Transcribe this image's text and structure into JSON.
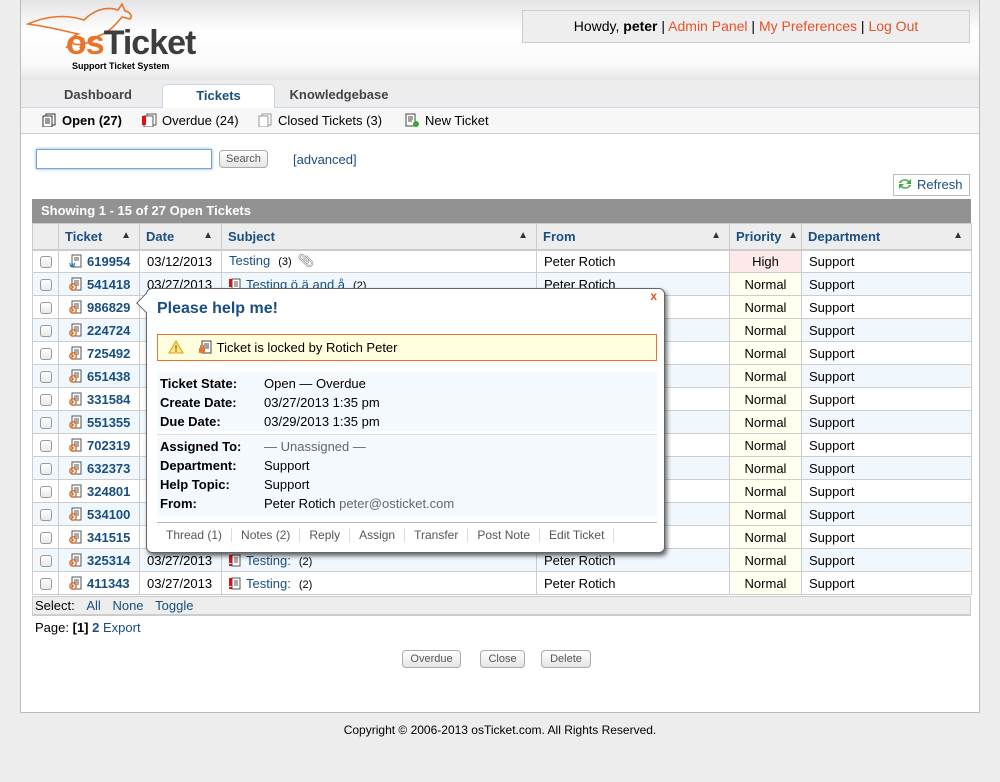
{
  "header": {
    "logo_os": "os",
    "logo_ticket": "Ticket",
    "tagline": "Support Ticket System",
    "greeting": "Howdy,",
    "username": "peter",
    "links": [
      "Admin Panel",
      "My Preferences",
      "Log Out"
    ],
    "link_color": "#e8502b"
  },
  "nav": {
    "tabs": [
      {
        "label": "Dashboard",
        "active": false
      },
      {
        "label": "Tickets",
        "active": true
      },
      {
        "label": "Knowledgebase",
        "active": false
      }
    ]
  },
  "subnav": {
    "items": [
      {
        "label": "Open (27)",
        "icon": "open-tickets-icon",
        "active": true
      },
      {
        "label": "Overdue (24)",
        "icon": "overdue-tickets-icon",
        "active": false
      },
      {
        "label": "Closed Tickets (3)",
        "icon": "closed-tickets-icon",
        "active": false
      },
      {
        "label": "New Ticket",
        "icon": "new-ticket-icon",
        "active": false
      }
    ]
  },
  "search": {
    "value": "",
    "placeholder": "",
    "button": "Search",
    "advanced": "[advanced]"
  },
  "refresh_label": "Refresh",
  "list": {
    "caption": "Showing  1 - 15 of 27   Open Tickets",
    "columns": [
      "Ticket",
      "Date",
      "Subject",
      "From",
      "Priority",
      "Department"
    ],
    "rows": [
      {
        "ticket": "619954",
        "source": "web",
        "date": "03/12/2013",
        "subject": "Testing",
        "overdue": false,
        "count": "(3)",
        "attachment": true,
        "from": "Peter Rotich",
        "priority": "High",
        "dept": "Support"
      },
      {
        "ticket": "541418",
        "source": "email",
        "date": "03/27/2013",
        "subject": "Testing ö.ä and å",
        "overdue": true,
        "count": "(2)",
        "attachment": false,
        "from": "Peter Rotich",
        "priority": "Normal",
        "dept": "Support"
      },
      {
        "ticket": "986829",
        "source": "email",
        "date": "",
        "subject": "",
        "overdue": false,
        "count": "",
        "attachment": false,
        "from": "",
        "priority": "Normal",
        "dept": "Support"
      },
      {
        "ticket": "224724",
        "source": "email",
        "date": "",
        "subject": "",
        "overdue": false,
        "count": "",
        "attachment": false,
        "from": "",
        "priority": "Normal",
        "dept": "Support"
      },
      {
        "ticket": "725492",
        "source": "email",
        "date": "",
        "subject": "",
        "overdue": false,
        "count": "",
        "attachment": false,
        "from": "",
        "priority": "Normal",
        "dept": "Support"
      },
      {
        "ticket": "651438",
        "source": "email",
        "date": "",
        "subject": "",
        "overdue": false,
        "count": "",
        "attachment": false,
        "from": "",
        "priority": "Normal",
        "dept": "Support"
      },
      {
        "ticket": "331584",
        "source": "email",
        "date": "",
        "subject": "",
        "overdue": false,
        "count": "",
        "attachment": false,
        "from": "",
        "priority": "Normal",
        "dept": "Support"
      },
      {
        "ticket": "551355",
        "source": "email",
        "date": "",
        "subject": "",
        "overdue": false,
        "count": "",
        "attachment": false,
        "from": "",
        "priority": "Normal",
        "dept": "Support"
      },
      {
        "ticket": "702319",
        "source": "email",
        "date": "",
        "subject": "",
        "overdue": false,
        "count": "",
        "attachment": false,
        "from": "",
        "priority": "Normal",
        "dept": "Support"
      },
      {
        "ticket": "632373",
        "source": "email",
        "date": "",
        "subject": "",
        "overdue": false,
        "count": "",
        "attachment": false,
        "from": "",
        "priority": "Normal",
        "dept": "Support"
      },
      {
        "ticket": "324801",
        "source": "email",
        "date": "",
        "subject": "",
        "overdue": false,
        "count": "",
        "attachment": false,
        "from": "",
        "priority": "Normal",
        "dept": "Support"
      },
      {
        "ticket": "534100",
        "source": "email",
        "date": "",
        "subject": "",
        "overdue": false,
        "count": "",
        "attachment": false,
        "from": "",
        "priority": "Normal",
        "dept": "Support"
      },
      {
        "ticket": "341515",
        "source": "email",
        "date": "",
        "subject": "",
        "overdue": false,
        "count": "",
        "attachment": false,
        "from": "",
        "priority": "Normal",
        "dept": "Support"
      },
      {
        "ticket": "325314",
        "source": "email",
        "date": "03/27/2013",
        "subject": "Testing:",
        "overdue": true,
        "count": "(2)",
        "attachment": false,
        "from": "Peter Rotich",
        "priority": "Normal",
        "dept": "Support"
      },
      {
        "ticket": "411343",
        "source": "email",
        "date": "03/27/2013",
        "subject": "Testing:",
        "overdue": true,
        "count": "(2)",
        "attachment": false,
        "from": "Peter Rotich",
        "priority": "Normal",
        "dept": "Support"
      }
    ]
  },
  "select_bar": {
    "label": "Select:",
    "all": "All",
    "none": "None",
    "toggle": "Toggle"
  },
  "pager": {
    "label": "Page:",
    "current": "[1]",
    "next": "2",
    "export": "Export"
  },
  "actions": [
    "Overdue",
    "Close",
    "Delete"
  ],
  "preview": {
    "title": "Please help me!",
    "close": "x",
    "lock_message": "Ticket is locked by Rotich Peter",
    "state_rows": [
      {
        "label": "Ticket State:",
        "value": "Open — Overdue"
      },
      {
        "label": "Create Date:",
        "value": "03/27/2013 1:35 pm"
      },
      {
        "label": "Due Date:",
        "value": "03/29/2013 1:35 pm"
      }
    ],
    "assign_rows": [
      {
        "label": "Assigned To:",
        "value": "— Unassigned —"
      },
      {
        "label": "Department:",
        "value": "Support"
      },
      {
        "label": "Help Topic:",
        "value": "Support"
      },
      {
        "label": "From:",
        "value": "Peter Rotich",
        "extra": "peter@osticket.com"
      }
    ],
    "actions": [
      "Thread (1)",
      "Notes (2)",
      "Reply",
      "Assign",
      "Transfer",
      "Post Note",
      "Edit Ticket"
    ]
  },
  "footer": "Copyright © 2006-2013 osTicket.com.  All Rights Reserved."
}
